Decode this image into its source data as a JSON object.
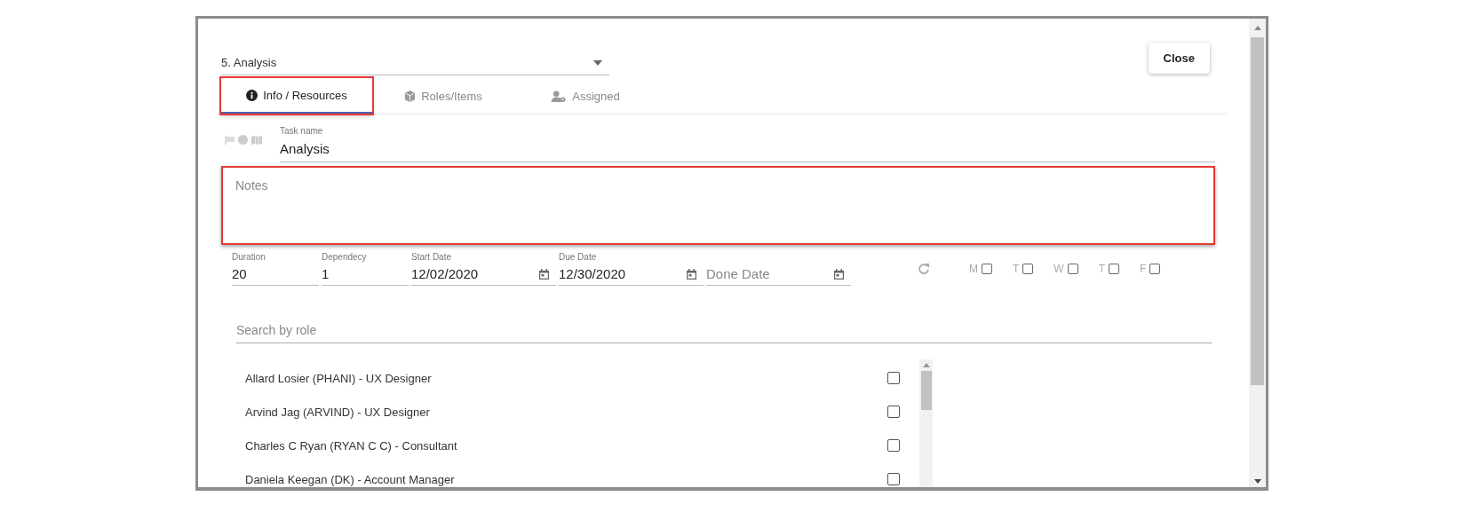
{
  "task_select": {
    "value": "5. Analysis"
  },
  "close_button": "Close",
  "tabs": [
    {
      "label": "Info / Resources",
      "kind": "info",
      "selected": true,
      "highlighted": true
    },
    {
      "label": "Roles/Items",
      "kind": "cube",
      "selected": false,
      "highlighted": false
    },
    {
      "label": "Assigned",
      "kind": "person",
      "selected": false,
      "highlighted": false
    }
  ],
  "task_name": {
    "label": "Task name",
    "value": "Analysis"
  },
  "notes": {
    "placeholder": "Notes",
    "highlighted": true
  },
  "fields": [
    {
      "kind": "text",
      "label": "Duration",
      "value": "20"
    },
    {
      "kind": "text",
      "label": "Dependecy",
      "value": "1"
    },
    {
      "kind": "date",
      "label": "Start Date",
      "value": "12/02/2020"
    },
    {
      "kind": "date",
      "label": "Due Date",
      "value": "12/30/2020"
    },
    {
      "kind": "date",
      "placeholder": "Done Date"
    }
  ],
  "weekdays": [
    {
      "label": "M",
      "checked": false
    },
    {
      "label": "T",
      "checked": false
    },
    {
      "label": "W",
      "checked": false
    },
    {
      "label": "T",
      "checked": false
    },
    {
      "label": "F",
      "checked": false
    }
  ],
  "role_search": {
    "placeholder": "Search by role"
  },
  "roles": [
    {
      "name": "Allard Losier (PHANI) - UX Designer",
      "checked": false
    },
    {
      "name": "Arvind Jag (ARVIND) - UX Designer",
      "checked": false
    },
    {
      "name": "Charles C Ryan (RYAN C C) - Consultant",
      "checked": false
    },
    {
      "name": "Daniela Keegan (DK) - Account Manager",
      "checked": false
    }
  ]
}
